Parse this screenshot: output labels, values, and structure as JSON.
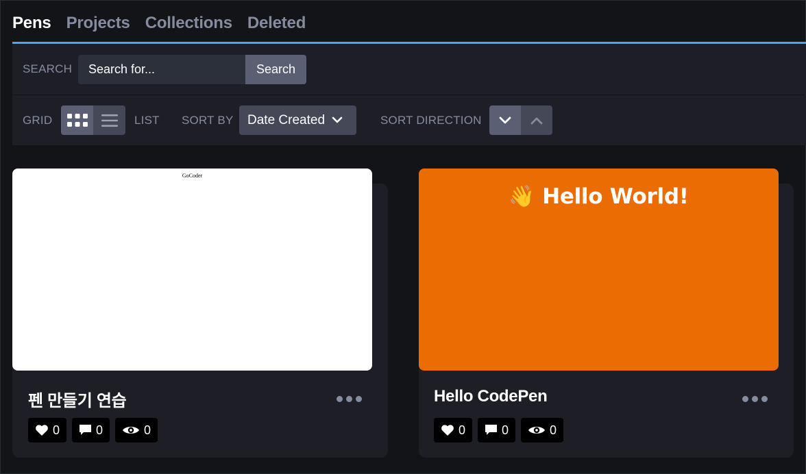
{
  "tabs": [
    {
      "label": "Pens",
      "active": true
    },
    {
      "label": "Projects",
      "active": false
    },
    {
      "label": "Collections",
      "active": false
    },
    {
      "label": "Deleted",
      "active": false
    }
  ],
  "search": {
    "label": "SEARCH",
    "placeholder": "Search for...",
    "button_label": "Search"
  },
  "view": {
    "grid_label": "GRID",
    "list_label": "LIST",
    "selected": "grid",
    "grid_icon": "grid-icon",
    "list_icon": "list-icon"
  },
  "sort": {
    "label": "SORT BY",
    "selected": "Date Created",
    "direction_label": "SORT DIRECTION",
    "direction": "descending"
  },
  "pens": [
    {
      "title": "펜 만들기 연습",
      "preview_text": "GoCoder",
      "likes": "0",
      "comments": "0",
      "views": "0"
    },
    {
      "title": "Hello CodePen",
      "preview_text": "👋 Hello World!",
      "likes": "0",
      "comments": "0",
      "views": "0"
    }
  ],
  "colors": {
    "accent": "#3fa9f5",
    "preview_orange": "#ec6c04"
  }
}
